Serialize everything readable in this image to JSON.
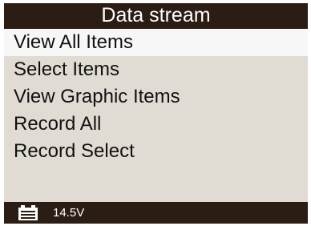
{
  "title": "Data stream",
  "menu": {
    "selected_index": 0,
    "items": [
      {
        "label": "View All Items"
      },
      {
        "label": "Select Items"
      },
      {
        "label": "View Graphic Items"
      },
      {
        "label": "Record All"
      },
      {
        "label": "Record Select"
      }
    ]
  },
  "status": {
    "icon": "battery-icon",
    "voltage": "14.5V"
  },
  "colors": {
    "bar_background": "#2b1c14",
    "screen_background": "#e0dcd4",
    "selected_row": "#f7f7f7",
    "text": "#111111",
    "bar_text": "#ffffff"
  }
}
